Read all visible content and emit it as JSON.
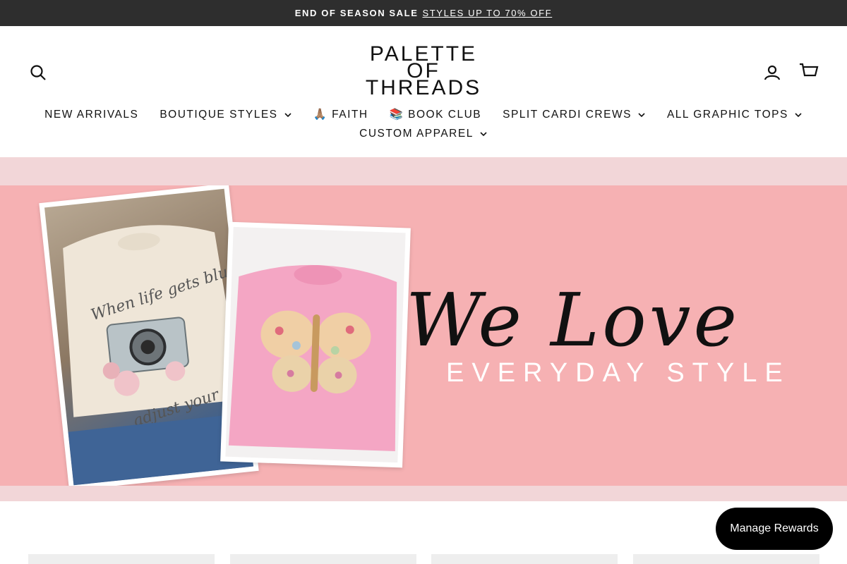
{
  "announcement": {
    "bold": "END OF SEASON SALE",
    "link": "STYLES UP TO 70% OFF"
  },
  "header": {
    "logo_lines": [
      "PALETTE",
      "OF",
      "THREADS"
    ],
    "icons": {
      "search": "search-icon",
      "account": "account-icon",
      "cart": "cart-icon"
    }
  },
  "nav": {
    "row1": [
      {
        "label": "NEW ARRIVALS",
        "dropdown": false
      },
      {
        "label": "BOUTIQUE STYLES",
        "dropdown": true
      },
      {
        "label": "🙏🏽 FAITH",
        "dropdown": false
      },
      {
        "label": "📚 BOOK CLUB",
        "dropdown": false
      },
      {
        "label": "SPLIT CARDI CREWS",
        "dropdown": true
      },
      {
        "label": "ALL GRAPHIC TOPS",
        "dropdown": true
      }
    ],
    "row2": [
      {
        "label": "CUSTOM APPAREL",
        "dropdown": true
      }
    ]
  },
  "hero": {
    "script": "We Love",
    "tagline": "EVERYDAY STYLE",
    "shirt1_text": [
      "When life gets blurry",
      "adjust your"
    ]
  },
  "rewards": {
    "label": "Manage Rewards"
  },
  "colors": {
    "announce_bg": "#2e2e2e",
    "hero_bg": "#f6b1b3",
    "band": "#f2d6d8",
    "rewards_bg": "#000000"
  }
}
